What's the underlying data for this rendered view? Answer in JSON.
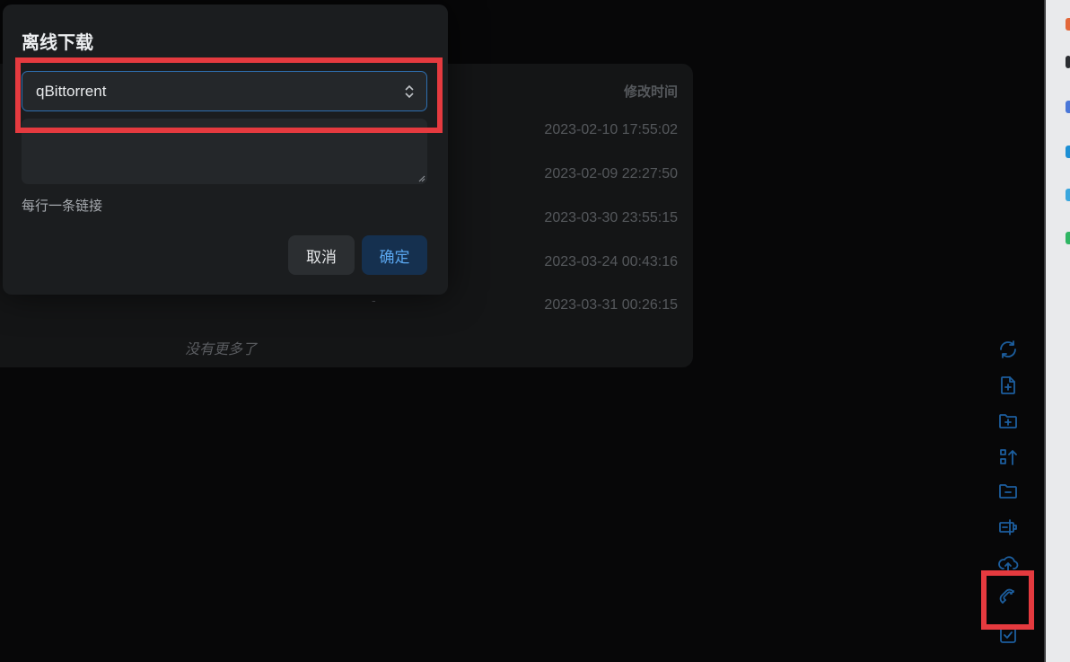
{
  "file_list": {
    "column_header": "修改时间",
    "dates": [
      "2023-02-10 17:55:02",
      "2023-02-09 22:27:50",
      "2023-03-30 23:55:15",
      "2023-03-24 00:43:16",
      "2023-03-31 00:26:15"
    ],
    "size_placeholder": "-",
    "end_text": "没有更多了"
  },
  "dialog": {
    "title": "离线下载",
    "tool_select": {
      "value": "qBittorrent"
    },
    "links_input": {
      "value": ""
    },
    "helper_text": "每行一条链接",
    "cancel_label": "取消",
    "ok_label": "确定"
  },
  "toolbar": {
    "icons": [
      "refresh-icon",
      "new-file-icon",
      "new-folder-icon",
      "sort-icon",
      "folder-minus-icon",
      "local-settings-icon",
      "upload-cloud-icon",
      "offline-download-magnet-icon",
      "checkbox-icon"
    ]
  },
  "colors": {
    "accent": "#2e6fb0",
    "highlight": "#e53a3f",
    "toolbar_icon": "#1c5e9e",
    "background": "#070708"
  }
}
